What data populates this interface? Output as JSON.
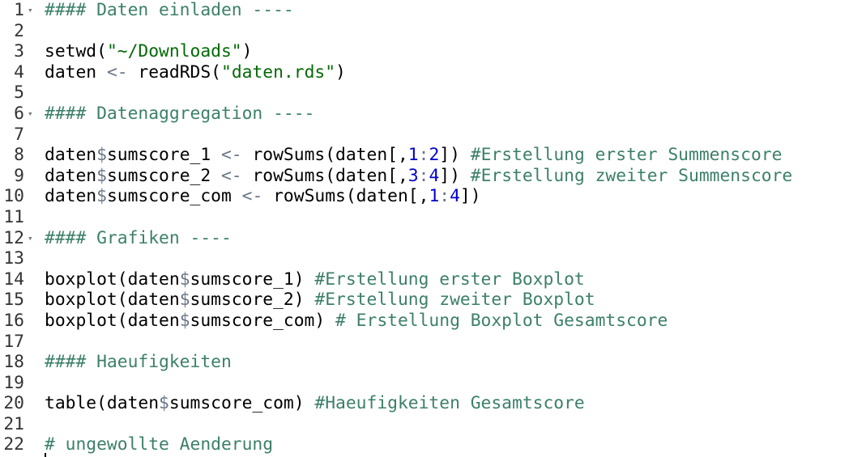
{
  "editor": {
    "lines": [
      {
        "num": "1",
        "fold": true,
        "tokens": [
          {
            "t": "#### Daten einladen ----",
            "k": "comment"
          }
        ]
      },
      {
        "num": "2",
        "fold": false,
        "tokens": []
      },
      {
        "num": "3",
        "fold": false,
        "tokens": [
          {
            "t": "setwd(",
            "k": "plain"
          },
          {
            "t": "\"~/Downloads\"",
            "k": "string"
          },
          {
            "t": ")",
            "k": "plain"
          }
        ]
      },
      {
        "num": "4",
        "fold": false,
        "tokens": [
          {
            "t": "daten ",
            "k": "plain"
          },
          {
            "t": "<-",
            "k": "op"
          },
          {
            "t": " readRDS(",
            "k": "plain"
          },
          {
            "t": "\"daten.rds\"",
            "k": "string"
          },
          {
            "t": ")",
            "k": "plain"
          }
        ]
      },
      {
        "num": "5",
        "fold": false,
        "tokens": []
      },
      {
        "num": "6",
        "fold": true,
        "tokens": [
          {
            "t": "#### Datenaggregation ----",
            "k": "comment"
          }
        ]
      },
      {
        "num": "7",
        "fold": false,
        "tokens": []
      },
      {
        "num": "8",
        "fold": false,
        "tokens": [
          {
            "t": "daten",
            "k": "plain"
          },
          {
            "t": "$",
            "k": "op"
          },
          {
            "t": "sumscore_1 ",
            "k": "plain"
          },
          {
            "t": "<-",
            "k": "op"
          },
          {
            "t": " rowSums(daten[,",
            "k": "plain"
          },
          {
            "t": "1",
            "k": "number"
          },
          {
            "t": ":",
            "k": "op"
          },
          {
            "t": "2",
            "k": "number"
          },
          {
            "t": "]) ",
            "k": "plain"
          },
          {
            "t": "#Erstellung erster Summenscore",
            "k": "comment"
          }
        ]
      },
      {
        "num": "9",
        "fold": false,
        "tokens": [
          {
            "t": "daten",
            "k": "plain"
          },
          {
            "t": "$",
            "k": "op"
          },
          {
            "t": "sumscore_2 ",
            "k": "plain"
          },
          {
            "t": "<-",
            "k": "op"
          },
          {
            "t": " rowSums(daten[,",
            "k": "plain"
          },
          {
            "t": "3",
            "k": "number"
          },
          {
            "t": ":",
            "k": "op"
          },
          {
            "t": "4",
            "k": "number"
          },
          {
            "t": "]) ",
            "k": "plain"
          },
          {
            "t": "#Erstellung zweiter Summenscore",
            "k": "comment"
          }
        ]
      },
      {
        "num": "10",
        "fold": false,
        "tokens": [
          {
            "t": "daten",
            "k": "plain"
          },
          {
            "t": "$",
            "k": "op"
          },
          {
            "t": "sumscore_com ",
            "k": "plain"
          },
          {
            "t": "<-",
            "k": "op"
          },
          {
            "t": " rowSums(daten[,",
            "k": "plain"
          },
          {
            "t": "1",
            "k": "number"
          },
          {
            "t": ":",
            "k": "op"
          },
          {
            "t": "4",
            "k": "number"
          },
          {
            "t": "])",
            "k": "plain"
          }
        ]
      },
      {
        "num": "11",
        "fold": false,
        "tokens": []
      },
      {
        "num": "12",
        "fold": true,
        "tokens": [
          {
            "t": "#### Grafiken ----",
            "k": "comment"
          }
        ]
      },
      {
        "num": "13",
        "fold": false,
        "tokens": []
      },
      {
        "num": "14",
        "fold": false,
        "tokens": [
          {
            "t": "boxplot(daten",
            "k": "plain"
          },
          {
            "t": "$",
            "k": "op"
          },
          {
            "t": "sumscore_1) ",
            "k": "plain"
          },
          {
            "t": "#Erstellung erster Boxplot",
            "k": "comment"
          }
        ]
      },
      {
        "num": "15",
        "fold": false,
        "tokens": [
          {
            "t": "boxplot(daten",
            "k": "plain"
          },
          {
            "t": "$",
            "k": "op"
          },
          {
            "t": "sumscore_2) ",
            "k": "plain"
          },
          {
            "t": "#Erstellung zweiter Boxplot",
            "k": "comment"
          }
        ]
      },
      {
        "num": "16",
        "fold": false,
        "tokens": [
          {
            "t": "boxplot(daten",
            "k": "plain"
          },
          {
            "t": "$",
            "k": "op"
          },
          {
            "t": "sumscore_com) ",
            "k": "plain"
          },
          {
            "t": "# Erstellung Boxplot Gesamtscore",
            "k": "comment"
          }
        ]
      },
      {
        "num": "17",
        "fold": false,
        "tokens": []
      },
      {
        "num": "18",
        "fold": false,
        "tokens": [
          {
            "t": "#### Haeufigkeiten",
            "k": "comment"
          }
        ]
      },
      {
        "num": "19",
        "fold": false,
        "tokens": []
      },
      {
        "num": "20",
        "fold": false,
        "tokens": [
          {
            "t": "table(daten",
            "k": "plain"
          },
          {
            "t": "$",
            "k": "op"
          },
          {
            "t": "sumscore_com) ",
            "k": "plain"
          },
          {
            "t": "#Haeufigkeiten Gesamtscore",
            "k": "comment"
          }
        ]
      },
      {
        "num": "21",
        "fold": false,
        "tokens": []
      },
      {
        "num": "22",
        "fold": false,
        "tokens": [
          {
            "t": "# ungewollte Aenderung",
            "k": "comment"
          }
        ]
      }
    ],
    "fold_glyph": "▾"
  }
}
